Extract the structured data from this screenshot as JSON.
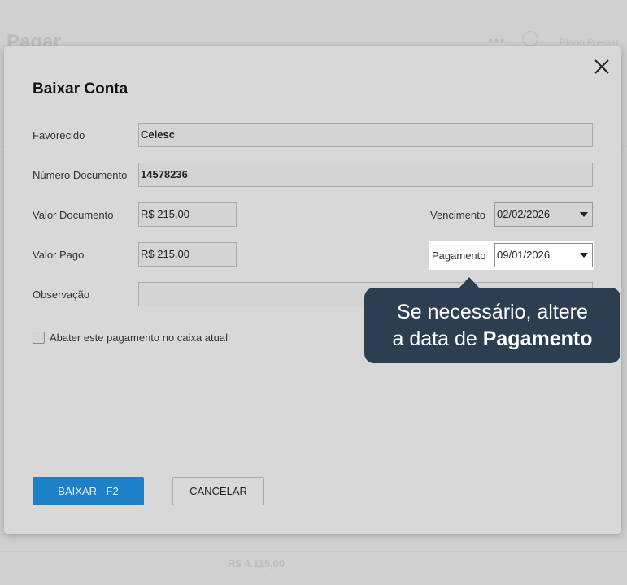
{
  "background": {
    "page_title": "Pagar",
    "more_label": "•••",
    "plan_label": "Plano Premiu",
    "total": "R$ 4.115,00"
  },
  "modal": {
    "title": "Baixar Conta",
    "favorecido": {
      "label": "Favorecido",
      "value": "Celesc"
    },
    "numero_documento": {
      "label": "Número Documento",
      "value": "14578236"
    },
    "valor_documento": {
      "label": "Valor Documento",
      "value": "R$ 215,00"
    },
    "vencimento": {
      "label": "Vencimento",
      "value": "02/02/2026"
    },
    "valor_pago": {
      "label": "Valor Pago",
      "value": "R$ 215,00"
    },
    "pagamento": {
      "label": "Pagamento",
      "value": "09/01/2026"
    },
    "observacao": {
      "label": "Observação",
      "value": ""
    },
    "abater_checkbox": {
      "label": "Abater este pagamento no caixa atual",
      "checked": false
    },
    "buttons": {
      "baixar": "BAIXAR - F2",
      "cancelar": "CANCELAR"
    }
  },
  "tooltip": {
    "line1": "Se necessário, altere",
    "line2_prefix": "a data de ",
    "line2_bold": "Pagamento"
  },
  "colors": {
    "primary_button": "#1d80c8",
    "tooltip_bg": "#2c3e50",
    "overlay": "#d0d0d0"
  }
}
